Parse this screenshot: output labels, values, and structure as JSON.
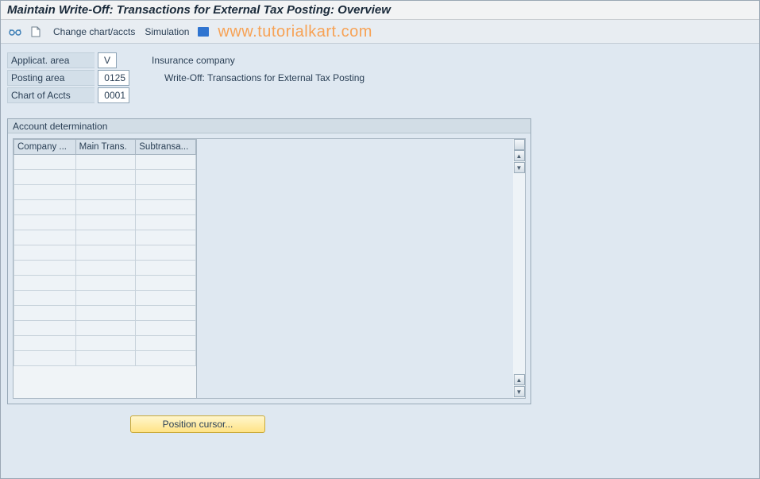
{
  "title": "Maintain Write-Off: Transactions for External Tax Posting: Overview",
  "toolbar": {
    "change_chart_label": "Change chart/accts",
    "simulation_label": "Simulation"
  },
  "watermark": "www.tutorialkart.com",
  "fields": {
    "applicat_area": {
      "label": "Applicat. area",
      "value": "V",
      "desc": "Insurance company"
    },
    "posting_area": {
      "label": "Posting area",
      "value": "0125",
      "desc": "Write-Off: Transactions for External Tax Posting"
    },
    "chart_of_accts": {
      "label": "Chart of Accts",
      "value": "0001",
      "desc": ""
    }
  },
  "panel": {
    "title": "Account determination",
    "columns": [
      "Company ...",
      "Main Trans.",
      "Subtransa..."
    ],
    "row_count": 14
  },
  "position_button": "Position cursor..."
}
